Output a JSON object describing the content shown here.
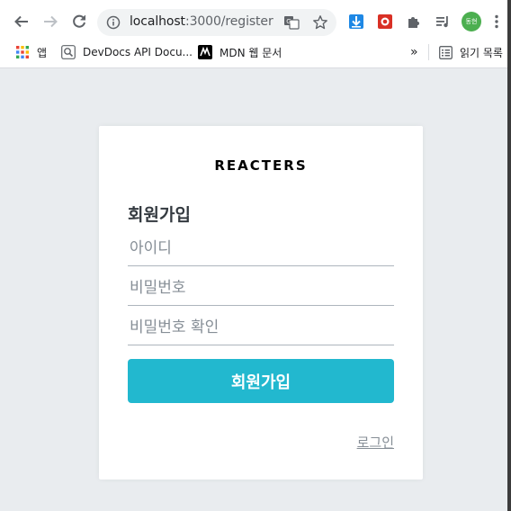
{
  "browser": {
    "url_host": "localhost",
    "url_path": ":3000/register",
    "profile_badge": "동현",
    "bookmarks": [
      {
        "label": "앱",
        "icon": "apps-grid-icon"
      },
      {
        "label": "DevDocs API Docu...",
        "icon": "devdocs-icon"
      },
      {
        "label": "MDN 웹 문서",
        "icon": "mdn-icon"
      }
    ],
    "overflow_label": "»",
    "reading_list_label": "읽기 목록"
  },
  "page": {
    "logo": "REACTERS",
    "title": "회원가입",
    "fields": {
      "username_placeholder": "아이디",
      "password_placeholder": "비밀번호",
      "password_confirm_placeholder": "비밀번호 확인"
    },
    "submit_label": "회원가입",
    "login_link": "로그인"
  },
  "colors": {
    "accent": "#22b8cf",
    "background": "#e9ecef"
  }
}
